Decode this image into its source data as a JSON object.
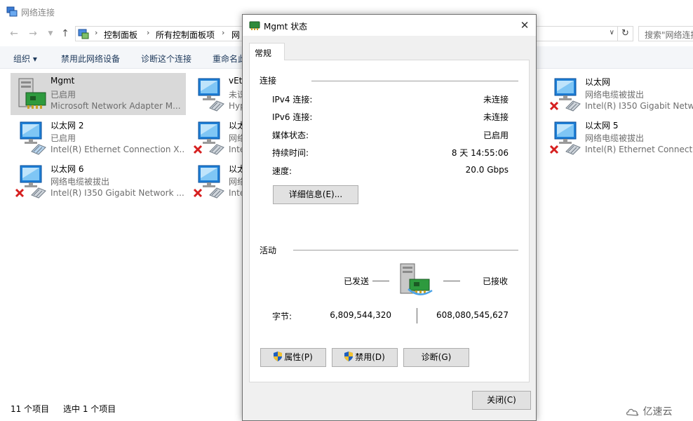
{
  "explorer": {
    "title": "网络连接",
    "nav": {
      "back_icon": "arrow-left-icon",
      "forward_icon": "arrow-right-icon",
      "recent_icon": "chevron-down-icon",
      "up_icon": "arrow-up-icon"
    },
    "address": {
      "crumbs": [
        "控制面板",
        "所有控制面板项",
        "网"
      ],
      "refresh_icon": "refresh-icon"
    },
    "search": {
      "placeholder": "搜索\"网络连接\""
    },
    "toolbar": {
      "organize": "组织 ▾",
      "disable_device": "禁用此网络设备",
      "diagnose": "诊断这个连接",
      "rename": "重命名此"
    },
    "items": [
      {
        "name": "Mgmt",
        "status": "已启用",
        "adapter": "Microsoft Network Adapter M...",
        "state": "enabled",
        "selected": true
      },
      {
        "name": "vEth",
        "status": "未识",
        "adapter": "Hyp",
        "state": "unidentified",
        "selected": false
      },
      {
        "name": "以太网",
        "status": "网络电缆被拔出",
        "adapter": "Intel(R) I350 Gigabit Netwo",
        "state": "unplugged",
        "selected": false
      },
      {
        "name": "以太网 2",
        "status": "已启用",
        "adapter": "Intel(R) Ethernet Connection X...",
        "state": "enabled",
        "selected": false
      },
      {
        "name": "以太",
        "status": "网络",
        "adapter": "Inte",
        "state": "unplugged",
        "selected": false
      },
      {
        "name": "以太网 5",
        "status": "网络电缆被拔出",
        "adapter": "Intel(R) Ethernet Connectio",
        "state": "unplugged",
        "selected": false
      },
      {
        "name": "以太网 6",
        "status": "网络电缆被拔出",
        "adapter": "Intel(R) I350 Gigabit Network ...",
        "state": "unplugged",
        "selected": false
      },
      {
        "name": "以太",
        "status": "网络",
        "adapter": "Inte",
        "state": "unplugged",
        "selected": false
      }
    ],
    "statusbar": {
      "count": "11 个项目",
      "selected": "选中 1 个项目"
    }
  },
  "dialog": {
    "title": "Mgmt 状态",
    "close_glyph": "✕",
    "tab": "常规",
    "connection": {
      "heading": "连接",
      "rows": [
        {
          "label": "IPv4 连接:",
          "value": "未连接"
        },
        {
          "label": "IPv6 连接:",
          "value": "未连接"
        },
        {
          "label": "媒体状态:",
          "value": "已启用"
        },
        {
          "label": "持续时间:",
          "value": "8 天 14:55:06"
        },
        {
          "label": "速度:",
          "value": "20.0 Gbps"
        }
      ],
      "details_button": "详细信息(E)..."
    },
    "activity": {
      "heading": "活动",
      "sent_label": "已发送",
      "received_label": "已接收",
      "bytes_label": "字节:",
      "bytes_sent": "6,809,544,320",
      "bytes_received": "608,080,545,627"
    },
    "buttons": {
      "properties": "属性(P)",
      "disable": "禁用(D)",
      "diagnose": "诊断(G)",
      "close": "关闭(C)"
    }
  },
  "watermark": {
    "text": "亿速云"
  },
  "colors": {
    "selection": "#d9d9d9",
    "toolbar_text": "#1e395b",
    "toolbar_bg": "#f4f6f9",
    "dialog_bg": "#f0f0f0",
    "error_x": "#d61f1f",
    "monitor_blue": "#1e7fd6"
  }
}
